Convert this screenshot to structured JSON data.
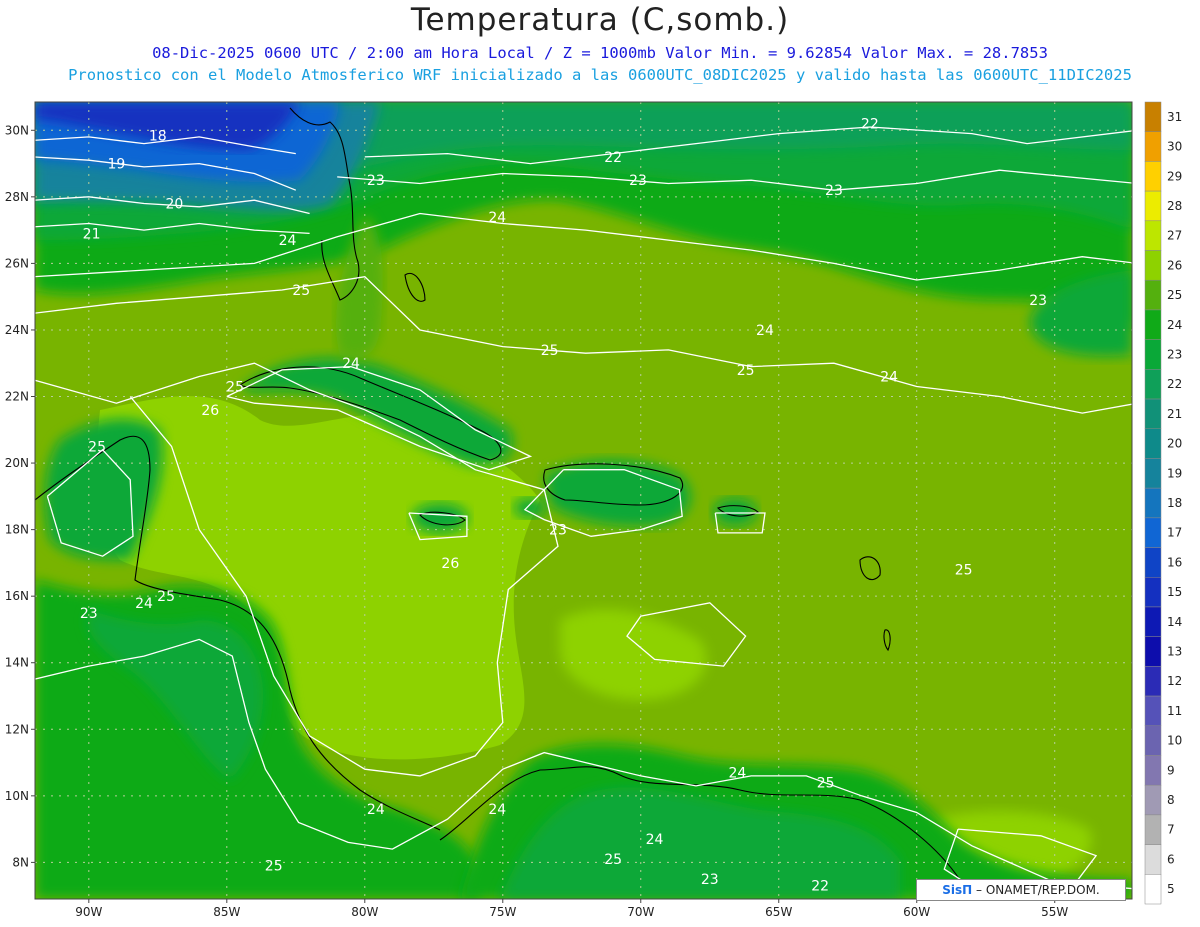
{
  "header": {
    "title": "Temperatura (C,somb.)",
    "subtitle_1": "08-Dic-2025  0600 UTC / 2:00 am Hora Local / Z = 1000mb   Valor Min. = 9.62854  Valor Max. = 28.7853",
    "subtitle_2": "Pronostico con el Modelo Atmosferico WRF inicializado a las 0600UTC_08DIC2025 y valido hasta las  0600UTC_11DIC2025"
  },
  "map": {
    "lat_labels": [
      "30N",
      "28N",
      "26N",
      "24N",
      "22N",
      "20N",
      "18N",
      "16N",
      "14N",
      "12N",
      "10N",
      "8N"
    ],
    "lon_labels": [
      "90W",
      "85W",
      "80W",
      "75W",
      "70W",
      "65W",
      "60W",
      "55W"
    ],
    "contour_labels": [
      {
        "t": "18",
        "lon": -87.5,
        "lat": 29.85
      },
      {
        "t": "19",
        "lon": -89.0,
        "lat": 29.0
      },
      {
        "t": "20",
        "lon": -86.9,
        "lat": 27.8
      },
      {
        "t": "21",
        "lon": -89.9,
        "lat": 26.9
      },
      {
        "t": "22",
        "lon": -71.0,
        "lat": 29.2
      },
      {
        "t": "22",
        "lon": -61.7,
        "lat": 30.2
      },
      {
        "t": "23",
        "lon": -79.6,
        "lat": 28.5
      },
      {
        "t": "23",
        "lon": -70.1,
        "lat": 28.5
      },
      {
        "t": "23",
        "lon": -63.0,
        "lat": 28.2
      },
      {
        "t": "23",
        "lon": -55.6,
        "lat": 24.9
      },
      {
        "t": "23",
        "lon": -90.0,
        "lat": 15.5
      },
      {
        "t": "23",
        "lon": -73.0,
        "lat": 18.0
      },
      {
        "t": "23",
        "lon": -67.5,
        "lat": 7.5
      },
      {
        "t": "24",
        "lon": -75.2,
        "lat": 27.4
      },
      {
        "t": "24",
        "lon": -82.8,
        "lat": 26.7
      },
      {
        "t": "24",
        "lon": -65.5,
        "lat": 24.0
      },
      {
        "t": "24",
        "lon": -61.0,
        "lat": 22.6
      },
      {
        "t": "24",
        "lon": -80.5,
        "lat": 23.0
      },
      {
        "t": "24",
        "lon": -88.0,
        "lat": 15.8
      },
      {
        "t": "24",
        "lon": -79.6,
        "lat": 9.6
      },
      {
        "t": "24",
        "lon": -75.2,
        "lat": 9.6
      },
      {
        "t": "24",
        "lon": -66.5,
        "lat": 10.7
      },
      {
        "t": "24",
        "lon": -69.5,
        "lat": 8.7
      },
      {
        "t": "25",
        "lon": -82.3,
        "lat": 25.2
      },
      {
        "t": "25",
        "lon": -73.3,
        "lat": 23.4
      },
      {
        "t": "25",
        "lon": -66.2,
        "lat": 22.8
      },
      {
        "t": "25",
        "lon": -84.7,
        "lat": 22.3
      },
      {
        "t": "25",
        "lon": -89.7,
        "lat": 20.5
      },
      {
        "t": "25",
        "lon": -87.2,
        "lat": 16.0
      },
      {
        "t": "25",
        "lon": -58.3,
        "lat": 16.8
      },
      {
        "t": "25",
        "lon": -63.3,
        "lat": 10.4
      },
      {
        "t": "25",
        "lon": -83.3,
        "lat": 7.9
      },
      {
        "t": "25",
        "lon": -71.0,
        "lat": 8.1
      },
      {
        "t": "26",
        "lon": -85.6,
        "lat": 21.6
      },
      {
        "t": "26",
        "lon": -76.9,
        "lat": 17.0
      },
      {
        "t": "22",
        "lon": -63.5,
        "lat": 7.3
      }
    ],
    "isolines": [
      {
        "v": "18",
        "pts": [
          [
            -92,
            29.7
          ],
          [
            -90,
            29.8
          ],
          [
            -88,
            29.6
          ],
          [
            -86,
            29.8
          ],
          [
            -84,
            29.5
          ],
          [
            -82.5,
            29.3
          ]
        ]
      },
      {
        "v": "19",
        "pts": [
          [
            -92,
            29.2
          ],
          [
            -90,
            29.1
          ],
          [
            -88,
            28.9
          ],
          [
            -86,
            29.0
          ],
          [
            -84,
            28.7
          ],
          [
            -82.5,
            28.2
          ]
        ]
      },
      {
        "v": "20",
        "pts": [
          [
            -92,
            27.9
          ],
          [
            -90,
            28.0
          ],
          [
            -88,
            27.8
          ],
          [
            -86,
            27.7
          ],
          [
            -84,
            27.9
          ],
          [
            -82,
            27.5
          ]
        ]
      },
      {
        "v": "21",
        "pts": [
          [
            -92,
            27.1
          ],
          [
            -90,
            27.2
          ],
          [
            -88,
            27.0
          ],
          [
            -86,
            27.2
          ],
          [
            -84,
            27.0
          ],
          [
            -82,
            26.9
          ]
        ]
      },
      {
        "v": "22",
        "pts": [
          [
            -80,
            29.2
          ],
          [
            -77,
            29.3
          ],
          [
            -74,
            29.0
          ],
          [
            -71,
            29.3
          ],
          [
            -68,
            29.6
          ],
          [
            -65,
            29.9
          ],
          [
            -61.7,
            30.1
          ],
          [
            -58,
            29.9
          ],
          [
            -56,
            29.6
          ],
          [
            -52,
            30.0
          ]
        ]
      },
      {
        "v": "23",
        "pts": [
          [
            -81,
            28.6
          ],
          [
            -78,
            28.4
          ],
          [
            -75,
            28.7
          ],
          [
            -72,
            28.6
          ],
          [
            -69,
            28.4
          ],
          [
            -66,
            28.5
          ],
          [
            -63,
            28.2
          ],
          [
            -60,
            28.4
          ],
          [
            -57,
            28.8
          ],
          [
            -52,
            28.4
          ]
        ]
      },
      {
        "v": "24",
        "pts": [
          [
            -92,
            25.6
          ],
          [
            -88,
            25.8
          ],
          [
            -84,
            26.0
          ],
          [
            -81,
            26.8
          ],
          [
            -78,
            27.5
          ],
          [
            -75,
            27.2
          ],
          [
            -72,
            27.0
          ],
          [
            -69,
            26.7
          ],
          [
            -66,
            26.4
          ],
          [
            -63,
            26.0
          ],
          [
            -60,
            25.5
          ],
          [
            -57,
            25.8
          ],
          [
            -54,
            26.2
          ],
          [
            -52,
            26.0
          ]
        ]
      },
      {
        "v": "25",
        "pts": [
          [
            -92,
            24.5
          ],
          [
            -89,
            24.8
          ],
          [
            -86,
            25.0
          ],
          [
            -83,
            25.2
          ],
          [
            -80,
            25.6
          ],
          [
            -78,
            24.0
          ],
          [
            -75,
            23.5
          ],
          [
            -72,
            23.3
          ],
          [
            -69,
            23.4
          ],
          [
            -66,
            22.9
          ],
          [
            -63,
            23.0
          ],
          [
            -60,
            22.3
          ],
          [
            -57,
            22.0
          ],
          [
            -54,
            21.5
          ],
          [
            -52,
            21.8
          ]
        ]
      },
      {
        "v": "26",
        "pts": [
          [
            -92,
            22.5
          ],
          [
            -89,
            21.8
          ],
          [
            -86,
            22.6
          ],
          [
            -84,
            23.0
          ],
          [
            -82,
            22.2
          ],
          [
            -80,
            21.6
          ],
          [
            -78,
            20.8
          ],
          [
            -76,
            19.8
          ],
          [
            -73.5,
            19.2
          ],
          [
            -73,
            17.5
          ],
          [
            -74.8,
            16.2
          ],
          [
            -75.2,
            14.0
          ],
          [
            -75.0,
            12.2
          ],
          [
            -76.0,
            11.2
          ],
          [
            -78,
            10.6
          ],
          [
            -80,
            10.8
          ],
          [
            -82,
            11.8
          ],
          [
            -83.3,
            13.6
          ],
          [
            -84.3,
            16.0
          ],
          [
            -86,
            18.0
          ],
          [
            -87.0,
            20.5
          ],
          [
            -88.5,
            22.0
          ]
        ]
      },
      {
        "v": "26",
        "pts": [
          [
            -70,
            15.4
          ],
          [
            -67.5,
            15.8
          ],
          [
            -66.2,
            14.8
          ],
          [
            -67,
            13.9
          ],
          [
            -69.5,
            14.1
          ],
          [
            -70.5,
            14.8
          ],
          [
            -70,
            15.4
          ]
        ]
      },
      {
        "v": "26",
        "pts": [
          [
            -58.5,
            9.0
          ],
          [
            -55.5,
            8.8
          ],
          [
            -53.5,
            8.2
          ],
          [
            -54.5,
            7.1
          ],
          [
            -57.5,
            7.0
          ],
          [
            -59.0,
            7.8
          ],
          [
            -58.5,
            9.0
          ]
        ]
      },
      {
        "v": "24",
        "pts": [
          [
            -92,
            13.5
          ],
          [
            -90,
            13.9
          ],
          [
            -88,
            14.2
          ],
          [
            -86,
            14.7
          ],
          [
            -84.8,
            14.2
          ],
          [
            -84.2,
            12.2
          ],
          [
            -83.6,
            10.8
          ],
          [
            -82.4,
            9.2
          ],
          [
            -80.6,
            8.6
          ],
          [
            -79,
            8.4
          ],
          [
            -77,
            9.3
          ],
          [
            -75,
            10.8
          ],
          [
            -73.5,
            11.3
          ],
          [
            -72,
            11.0
          ],
          [
            -70,
            10.6
          ],
          [
            -68,
            10.3
          ],
          [
            -66,
            10.6
          ],
          [
            -64,
            10.6
          ],
          [
            -62,
            10.0
          ],
          [
            -60,
            9.5
          ],
          [
            -58,
            8.5
          ],
          [
            -55,
            7.4
          ],
          [
            -52,
            7.2
          ]
        ]
      },
      {
        "v": "24",
        "pts": [
          [
            -85,
            22.0
          ],
          [
            -83,
            22.8
          ],
          [
            -80.5,
            22.9
          ],
          [
            -78,
            22.2
          ],
          [
            -76,
            21.0
          ],
          [
            -74,
            20.2
          ],
          [
            -75.5,
            19.8
          ],
          [
            -78,
            20.5
          ],
          [
            -81,
            21.6
          ],
          [
            -84,
            21.8
          ],
          [
            -85,
            22.0
          ]
        ]
      },
      {
        "v": "23",
        "pts": [
          [
            -72.8,
            19.8
          ],
          [
            -70.6,
            19.8
          ],
          [
            -68.6,
            19.2
          ],
          [
            -68.5,
            18.4
          ],
          [
            -70,
            18.0
          ],
          [
            -71.8,
            17.8
          ],
          [
            -73.5,
            18.3
          ],
          [
            -74.2,
            18.6
          ],
          [
            -72.8,
            19.8
          ]
        ]
      },
      {
        "v": "23",
        "pts": [
          [
            -78.4,
            18.5
          ],
          [
            -76.3,
            18.4
          ],
          [
            -76.3,
            17.8
          ],
          [
            -78.0,
            17.7
          ],
          [
            -78.4,
            18.5
          ]
        ]
      },
      {
        "v": "23",
        "pts": [
          [
            -67.3,
            18.5
          ],
          [
            -65.5,
            18.5
          ],
          [
            -65.6,
            17.9
          ],
          [
            -67.2,
            17.9
          ],
          [
            -67.3,
            18.5
          ]
        ]
      },
      {
        "v": "23",
        "pts": [
          [
            -91.5,
            19.0
          ],
          [
            -89.5,
            20.4
          ],
          [
            -88.5,
            19.5
          ],
          [
            -88.4,
            17.8
          ],
          [
            -89.5,
            17.2
          ],
          [
            -91.0,
            17.6
          ],
          [
            -91.5,
            19.0
          ]
        ]
      }
    ],
    "legend": {
      "values": [
        "5",
        "6",
        "7",
        "8",
        "9",
        "10",
        "11",
        "12",
        "13",
        "14",
        "15",
        "16",
        "17",
        "18",
        "19",
        "20",
        "21",
        "22",
        "23",
        "24",
        "25",
        "26",
        "27",
        "28",
        "29",
        "30",
        "31"
      ],
      "colors": [
        "#ffffff",
        "#dcdcdc",
        "#b2b2b2",
        "#a09ab4",
        "#8277b0",
        "#6b64b0",
        "#5552b8",
        "#2b2bb6",
        "#0d0dac",
        "#0d19b4",
        "#1430c0",
        "#0f44c6",
        "#1066d4",
        "#1475be",
        "#15839c",
        "#0e8a8a",
        "#119178",
        "#0fa059",
        "#0aa838",
        "#10aa18",
        "#54b00e",
        "#8ed200",
        "#bde600",
        "#ecec00",
        "#ffd000",
        "#f0a000",
        "#c88000"
      ]
    },
    "credit": {
      "brand": "SisΠ",
      "text": "– ONAMET/REP.DOM."
    }
  }
}
